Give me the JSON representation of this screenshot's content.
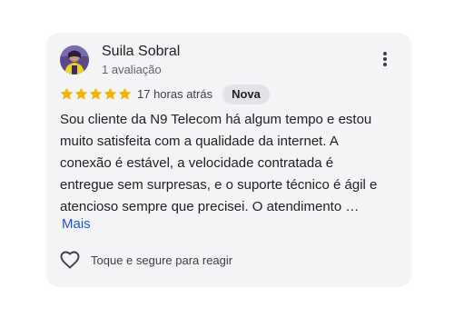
{
  "review": {
    "author": {
      "name": "Suila Sobral",
      "review_count": "1 avaliação",
      "avatar_icon": "profile-photo"
    },
    "rating": 5,
    "rating_max": 5,
    "star_color": "#f5b400",
    "time_ago": "17 horas atrás",
    "badge": "Nova",
    "text_lines": [
      "Sou cliente da N9 Telecom há algum tempo e estou",
      "muito satisfeita com a qualidade da internet. A",
      "conexão é estável, a velocidade contratada é",
      "entregue sem surpresas, e o suporte técnico é ágil e",
      "atencioso sempre que precisei. O atendimento …"
    ],
    "more_label": "Mais",
    "more_link_color": "#1a56c9",
    "reaction": {
      "icon": "heart-outline-icon",
      "label": "Toque e segure para reagir"
    },
    "menu_icon": "more-vert-icon"
  }
}
